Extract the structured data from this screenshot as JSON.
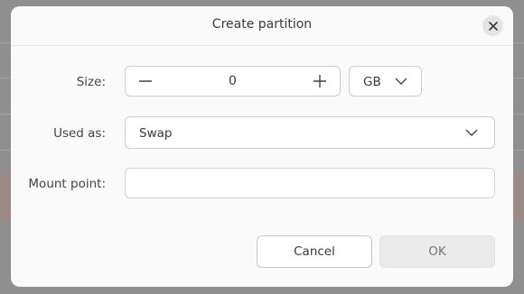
{
  "dialog": {
    "title": "Create partition",
    "close_icon": "close-icon"
  },
  "size": {
    "label": "Size:",
    "value": "0",
    "decrement_icon": "minus-icon",
    "increment_icon": "plus-icon",
    "unit": "GB"
  },
  "used_as": {
    "label": "Used as:",
    "value": "Swap"
  },
  "mount_point": {
    "label": "Mount point:",
    "value": "",
    "placeholder": ""
  },
  "buttons": {
    "cancel": "Cancel",
    "ok": "OK"
  },
  "colors": {
    "dialog_bg": "#fafafa",
    "overlay": "#8f8f8f",
    "field_border": "#cdcdcd",
    "ok_disabled_bg": "#ebebeb"
  }
}
